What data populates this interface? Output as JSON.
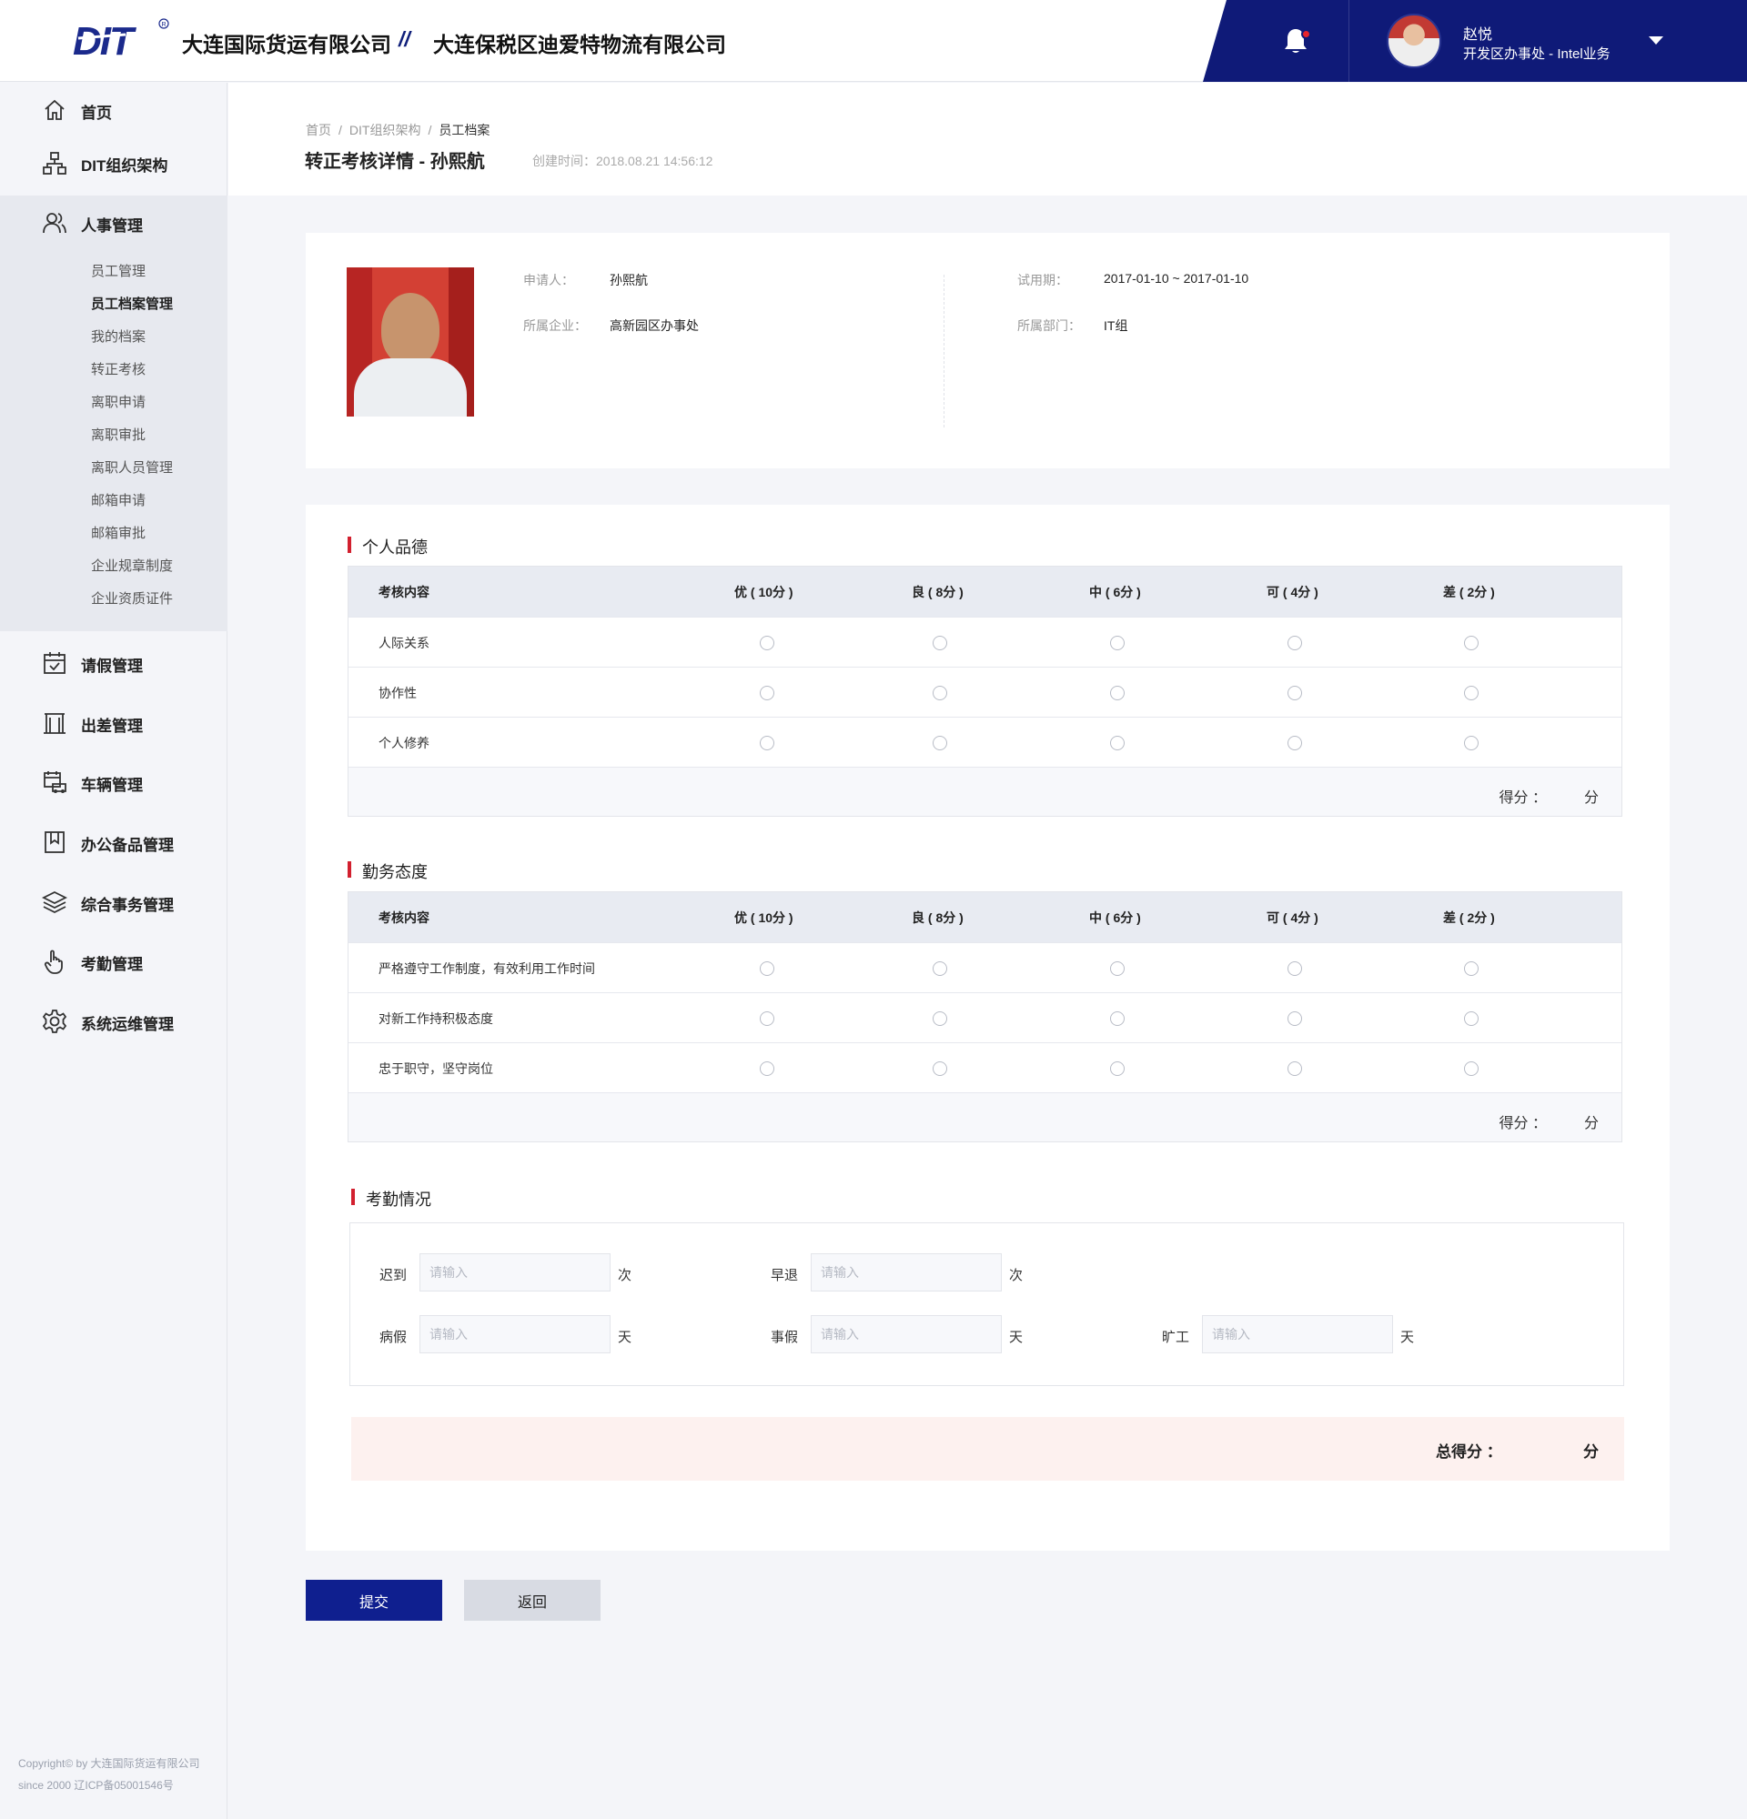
{
  "header": {
    "logo_text": "DIT",
    "company_1": "大连国际货运有限公司",
    "separator": "//",
    "company_2": "大连保税区迪爱特物流有限公司",
    "user": {
      "name": "赵悦",
      "org": "开发区办事处 - Intel业务"
    }
  },
  "sidebar": {
    "items": [
      {
        "label": "首页",
        "icon": "home-icon"
      },
      {
        "label": "DIT组织架构",
        "icon": "org-chart-icon"
      },
      {
        "label": "人事管理",
        "icon": "users-icon"
      },
      {
        "label": "请假管理",
        "icon": "calendar-check-icon"
      },
      {
        "label": "出差管理",
        "icon": "gate-icon"
      },
      {
        "label": "车辆管理",
        "icon": "vehicle-icon"
      },
      {
        "label": "办公备品管理",
        "icon": "bookmark-icon"
      },
      {
        "label": "综合事务管理",
        "icon": "layers-icon"
      },
      {
        "label": "考勤管理",
        "icon": "hand-pointer-icon"
      },
      {
        "label": "系统运维管理",
        "icon": "gear-icon"
      }
    ],
    "hr_sub_items": [
      "员工管理",
      "员工档案管理",
      "我的档案",
      "转正考核",
      "离职申请",
      "离职审批",
      "离职人员管理",
      "邮箱申请",
      "邮箱审批",
      "企业规章制度",
      "企业资质证件"
    ],
    "active_sub_item": "员工档案管理",
    "copyright_1": "Copyright© by 大连国际货运有限公司",
    "copyright_2": "since 2000 辽ICP备05001546号"
  },
  "page": {
    "breadcrumb": [
      "首页",
      "DIT组织架构",
      "员工档案"
    ],
    "breadcrumb_sep": "/",
    "title": "转正考核详情  - 孙熙航",
    "created": "创建时间：2018.08.21   14:56:12"
  },
  "profile": {
    "applicant_label": "申请人：",
    "applicant": "孙熙航",
    "company_label": "所属企业：",
    "company": "高新园区办事处",
    "period_label": "试用期：",
    "period": "2017-01-10 ~  2017-01-10",
    "dept_label": "所属部门：",
    "dept": "IT组"
  },
  "grades": [
    "优 ( 10分 )",
    "良 ( 8分 )",
    "中 ( 6分 )",
    "可 ( 4分 )",
    "差 ( 2分 )"
  ],
  "content_header": "考核内容",
  "sections": [
    {
      "title": "个人品德",
      "rows": [
        "人际关系",
        "协作性",
        "个人修养"
      ],
      "score_label": "得分 ：",
      "score_unit": "分"
    },
    {
      "title": "勤务态度",
      "rows": [
        "严格遵守工作制度，有效利用工作时间",
        "对新工作持积极态度",
        "忠于职守，坚守岗位"
      ],
      "score_label": "得分 ：",
      "score_unit": "分"
    }
  ],
  "attendance": {
    "title": "考勤情况",
    "placeholder": "请输入",
    "late_label": "迟到",
    "late_unit": "次",
    "early_label": "早退",
    "early_unit": "次",
    "sick_label": "病假",
    "sick_unit": "天",
    "personal_label": "事假",
    "personal_unit": "天",
    "absent_label": "旷工",
    "absent_unit": "天"
  },
  "total": {
    "label": "总得分 ：",
    "unit": "分"
  },
  "buttons": {
    "submit": "提交",
    "back": "返回"
  }
}
